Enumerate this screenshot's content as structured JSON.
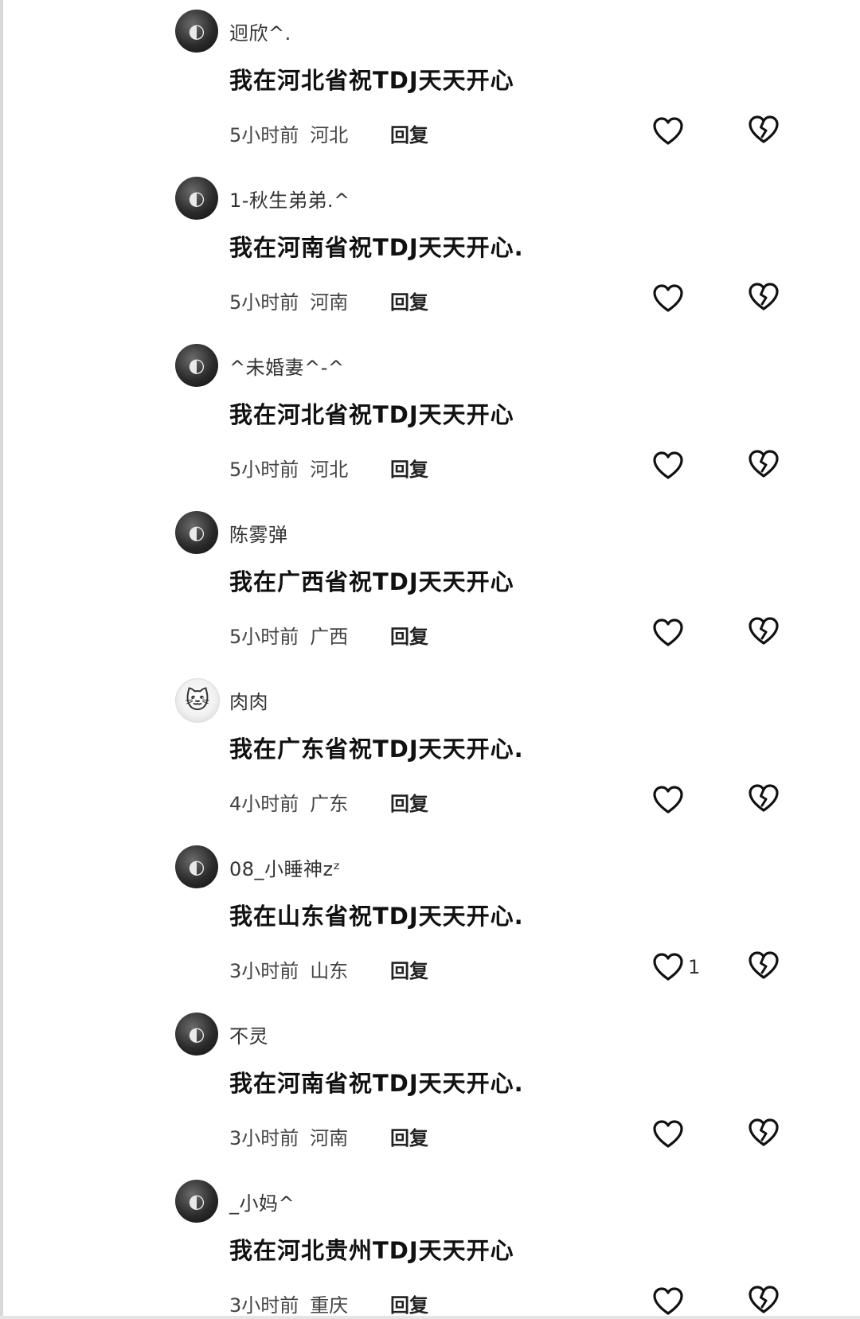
{
  "comments": [
    {
      "username": "迥欣^.",
      "text": "我在河北省祝TDJ天天开心",
      "time": "5小时前",
      "location": "河北",
      "reply": "回复",
      "likes": "",
      "avatar_icon": "dark-avatar-icon"
    },
    {
      "username": "1-秋生弟弟.^",
      "text": "我在河南省祝TDJ天天开心.",
      "time": "5小时前",
      "location": "河南",
      "reply": "回复",
      "likes": "",
      "avatar_icon": "dark-avatar-icon"
    },
    {
      "username": "^未婚妻^-^",
      "text": "我在河北省祝TDJ天天开心",
      "time": "5小时前",
      "location": "河北",
      "reply": "回复",
      "likes": "",
      "avatar_icon": "dark-avatar-icon"
    },
    {
      "username": "陈雾弹",
      "text": "我在广西省祝TDJ天天开心",
      "time": "5小时前",
      "location": "广西",
      "reply": "回复",
      "likes": "",
      "avatar_icon": "dark-avatar-icon"
    },
    {
      "username": "肉肉",
      "text": "我在广东省祝TDJ天天开心.",
      "time": "4小时前",
      "location": "广东",
      "reply": "回复",
      "likes": "",
      "avatar_icon": "hello-kitty-avatar-icon"
    },
    {
      "username": "08_小睡神zᶻ",
      "text": "我在山东省祝TDJ天天开心.",
      "time": "3小时前",
      "location": "山东",
      "reply": "回复",
      "likes": "1",
      "avatar_icon": "dark-avatar-icon"
    },
    {
      "username": "不灵",
      "text": "我在河南省祝TDJ天天开心.",
      "time": "3小时前",
      "location": "河南",
      "reply": "回复",
      "likes": "",
      "avatar_icon": "dark-avatar-icon"
    },
    {
      "username": "_小妈^",
      "text": "我在河北贵州TDJ天天开心",
      "time": "3小时前",
      "location": "重庆",
      "reply": "回复",
      "likes": "",
      "avatar_icon": "dark-avatar-icon"
    }
  ],
  "icons": {
    "like": "heart-outline-icon",
    "dislike": "broken-heart-icon"
  },
  "colors": {
    "text": "#111111",
    "meta": "#444444",
    "background": "#ffffff"
  }
}
